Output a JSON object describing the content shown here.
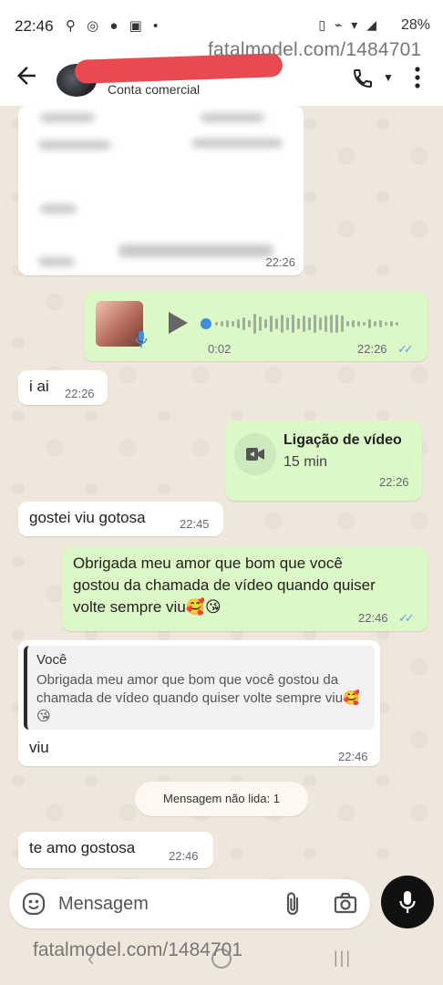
{
  "status_bar": {
    "time": "22:46",
    "battery": "28%"
  },
  "watermark": {
    "top": "fatalmodel.com/1484701",
    "bottom": "fatalmodel.com/1484701"
  },
  "header": {
    "subtitle": "Conta comercial"
  },
  "messages": {
    "m1": {
      "time": "22:26"
    },
    "m2": {
      "duration": "0:02",
      "time": "22:26",
      "ticks": "✓✓"
    },
    "m3": {
      "text": "i ai",
      "time": "22:26"
    },
    "m4": {
      "title": "Ligação de vídeo",
      "duration": "15 min",
      "time": "22:26"
    },
    "m5": {
      "text": "gostei viu gotosa",
      "time": "22:45"
    },
    "m6": {
      "text": "Obrigada meu amor que bom que você gostou da chamada de vídeo quando quiser volte sempre viu🥰😘",
      "time": "22:46",
      "ticks": "✓✓"
    },
    "m7": {
      "quote_author": "Você",
      "quote_text": "Obrigada meu amor que bom que você gostou da chamada de vídeo quando quiser volte sempre viu🥰😘",
      "text": "viu",
      "time": "22:46"
    },
    "unread": "Mensagem não lida: 1",
    "m8": {
      "text": "te amo gostosa",
      "time": "22:46"
    }
  },
  "input": {
    "placeholder": "Mensagem"
  },
  "colors": {
    "outgoing_bubble": "#dcf8c6",
    "incoming_bubble": "#ffffff",
    "read_ticks": "#4fa6e8",
    "redaction": "#e94a4f"
  },
  "icons": [
    "back-arrow-icon",
    "phone-icon",
    "more-vert-icon",
    "play-icon",
    "mic-icon",
    "video-camera-icon",
    "emoji-icon",
    "attach-icon",
    "camera-icon",
    "send-mic-icon"
  ]
}
